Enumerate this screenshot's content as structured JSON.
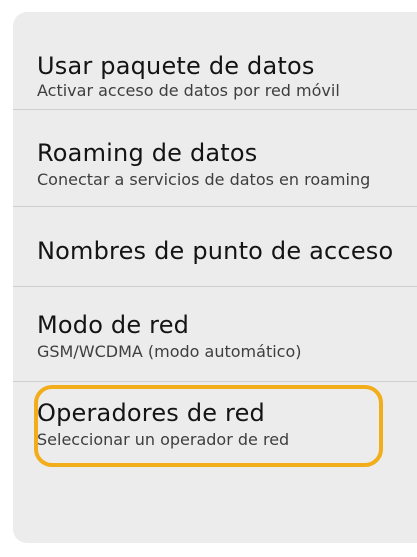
{
  "settings": {
    "items": [
      {
        "title": "Usar paquete de datos",
        "subtitle": "Activar acceso de datos por red móvil"
      },
      {
        "title": "Roaming de datos",
        "subtitle": "Conectar a servicios de datos en roaming"
      },
      {
        "title": "Nombres de punto de acceso",
        "subtitle": ""
      },
      {
        "title": "Modo de red",
        "subtitle": "GSM/WCDMA (modo automático)"
      },
      {
        "title": "Operadores de red",
        "subtitle": "Seleccionar un operador de red"
      }
    ]
  },
  "colors": {
    "highlight": "#f2ad1b",
    "panel": "#ececec"
  }
}
